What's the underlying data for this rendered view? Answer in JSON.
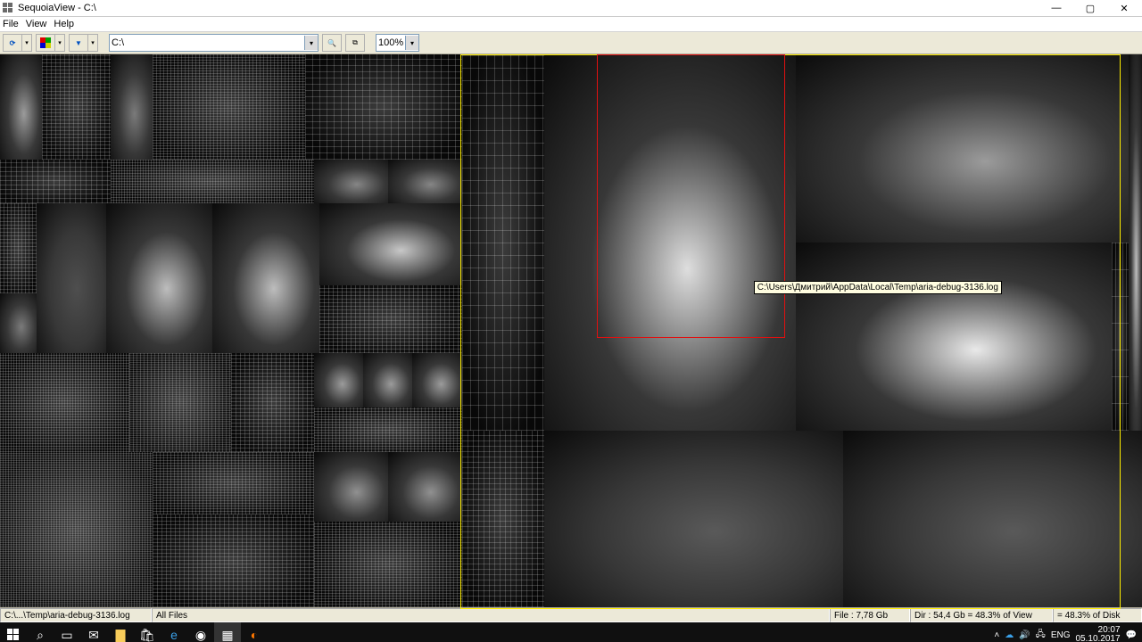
{
  "titlebar": {
    "title": "SequoiaView - C:\\"
  },
  "menu": {
    "file": "File",
    "view": "View",
    "help": "Help"
  },
  "toolbar": {
    "path": "C:\\",
    "zoom": "100%"
  },
  "tooltip": "C:\\Users\\Дмитрий\\AppData\\Local\\Temp\\aria-debug-3136.log",
  "status": {
    "path": "C:\\...\\Temp\\aria-debug-3136.log",
    "filter": "All Files",
    "file": "File : 7,78 Gb",
    "dir": "Dir : 54,4 Gb = 48.3% of View",
    "disk": "= 48.3% of Disk"
  },
  "tray": {
    "lang": "ENG",
    "time": "20:07",
    "date": "05.10.2017"
  }
}
